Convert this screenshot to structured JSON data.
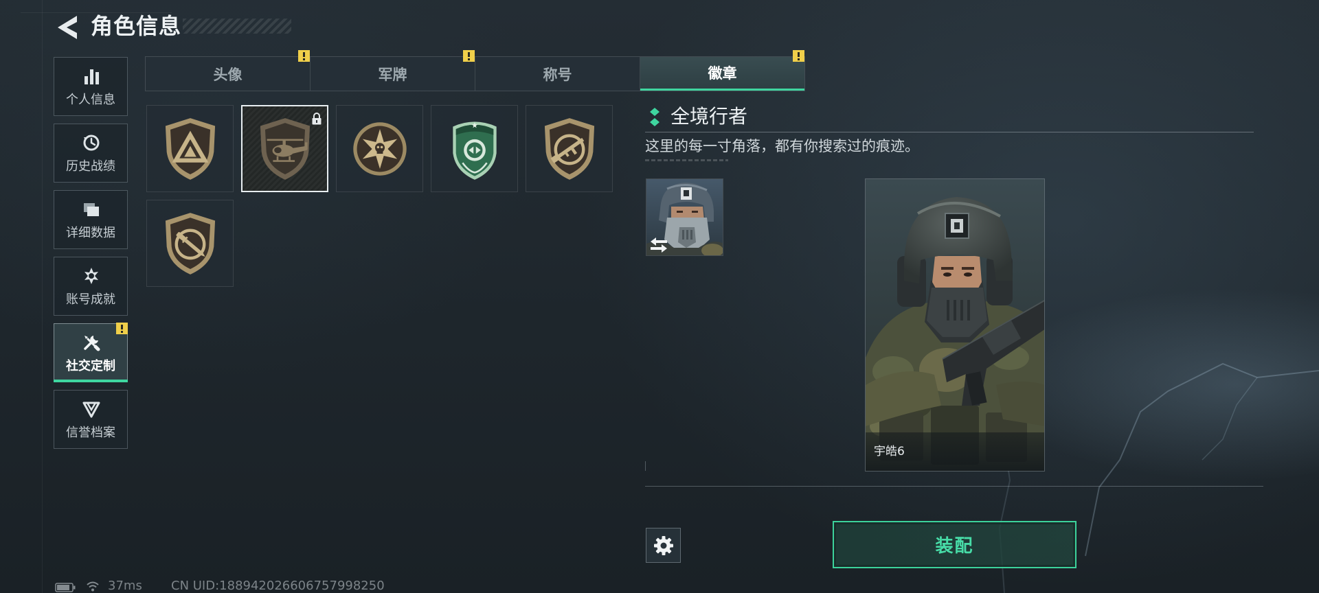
{
  "header": {
    "title": "角色信息",
    "back_icon": "back-arrow-icon"
  },
  "sidebar": {
    "items": [
      {
        "label": "个人信息",
        "icon": "bar-chart-icon",
        "active": false,
        "alert": false
      },
      {
        "label": "历史战绩",
        "icon": "history-icon",
        "active": false,
        "alert": false
      },
      {
        "label": "详细数据",
        "icon": "folders-icon",
        "active": false,
        "alert": false
      },
      {
        "label": "账号成就",
        "icon": "achievement-icon",
        "active": false,
        "alert": false
      },
      {
        "label": "社交定制",
        "icon": "tools-icon",
        "active": true,
        "alert": true
      },
      {
        "label": "信誉档案",
        "icon": "reputation-icon",
        "active": false,
        "alert": false
      }
    ]
  },
  "tabs": [
    {
      "label": "头像",
      "active": false,
      "alert": true
    },
    {
      "label": "军牌",
      "active": false,
      "alert": true
    },
    {
      "label": "称号",
      "active": false,
      "alert": false
    },
    {
      "label": "徽章",
      "active": true,
      "alert": true
    }
  ],
  "badges": [
    {
      "icon": "triangle-badge",
      "locked": false,
      "selected": false
    },
    {
      "icon": "helicopter-badge",
      "locked": true,
      "selected": true
    },
    {
      "icon": "star-skull-badge",
      "locked": false,
      "selected": false
    },
    {
      "icon": "green-shield-badge",
      "locked": false,
      "selected": false
    },
    {
      "icon": "rifle-badge",
      "locked": false,
      "selected": false
    },
    {
      "icon": "knife-badge",
      "locked": false,
      "selected": false
    }
  ],
  "detail": {
    "title": "全境行者",
    "description": "这里的每一寸角落，都有你搜索过的痕迹。"
  },
  "character": {
    "name": "宇皓6"
  },
  "actions": {
    "equip_label": "装配",
    "settings_icon": "gear-icon",
    "swap_icon": "swap-icon"
  },
  "status": {
    "ping": "37ms",
    "uid": "CN UID:188942026606757998250"
  },
  "colors": {
    "accent": "#3fd6a0",
    "alert": "#f0cf4a",
    "badge_tan": "#c7b489"
  }
}
